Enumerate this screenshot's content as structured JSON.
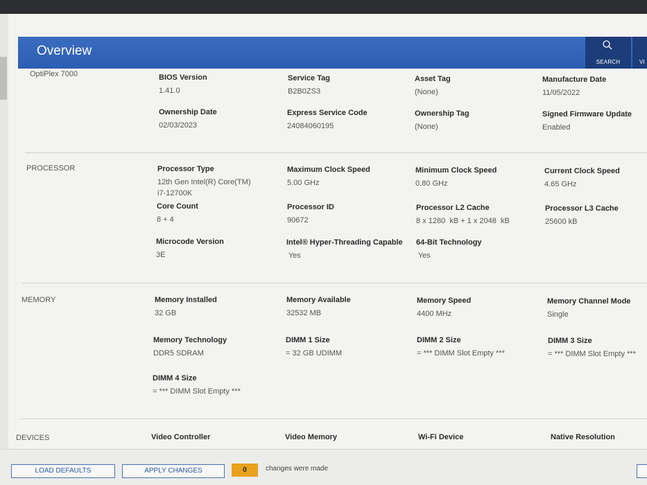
{
  "header": {
    "title": "Overview",
    "search_label": "SEARCH",
    "view_label": "VI"
  },
  "system": {
    "model": "OptiPlex 7000",
    "fields": [
      {
        "label": "BIOS Version",
        "value": "1.41.0"
      },
      {
        "label": "Service Tag",
        "value": "B2B0ZS3"
      },
      {
        "label": "Asset Tag",
        "value": "(None)"
      },
      {
        "label": "Manufacture Date",
        "value": "11/05/2022"
      },
      {
        "label": "Ownership Date",
        "value": "02/03/2023"
      },
      {
        "label": "Express Service Code",
        "value": "24084060195"
      },
      {
        "label": "Ownership Tag",
        "value": "(None)"
      },
      {
        "label": "Signed Firmware Update",
        "value": "Enabled"
      }
    ]
  },
  "processor": {
    "section": "PROCESSOR",
    "fields": [
      {
        "label": "Processor Type",
        "value": "12th Gen Intel(R) Core(TM)\ni7-12700K"
      },
      {
        "label": "Maximum Clock Speed",
        "value": "5.00 GHz"
      },
      {
        "label": "Minimum Clock Speed",
        "value": "0.80 GHz"
      },
      {
        "label": "Current Clock Speed",
        "value": "4.65 GHz"
      },
      {
        "label": "Core Count",
        "value": "8 + 4"
      },
      {
        "label": "Processor ID",
        "value": "90672"
      },
      {
        "label": "Processor L2 Cache",
        "value": "8 x 1280  kB + 1 x 2048  kB"
      },
      {
        "label": "Processor L3 Cache",
        "value": "25600 kB"
      },
      {
        "label": "Microcode Version",
        "value": "3E"
      },
      {
        "label": "Intel® Hyper-Threading Capable",
        "value": " Yes"
      },
      {
        "label": "64-Bit Technology",
        "value": " Yes"
      }
    ]
  },
  "memory": {
    "section": "MEMORY",
    "fields": [
      {
        "label": "Memory Installed",
        "value": "32 GB"
      },
      {
        "label": "Memory Available",
        "value": "32532 MB"
      },
      {
        "label": "Memory Speed",
        "value": "4400 MHz"
      },
      {
        "label": "Memory Channel Mode",
        "value": "Single"
      },
      {
        "label": "Memory Technology",
        "value": "DDR5 SDRAM"
      },
      {
        "label": "DIMM 1 Size",
        "value": "= 32 GB UDIMM"
      },
      {
        "label": "DIMM 2 Size",
        "value": "= *** DIMM Slot Empty ***"
      },
      {
        "label": "DIMM 3 Size",
        "value": "= *** DIMM Slot Empty ***"
      },
      {
        "label": "DIMM 4 Size",
        "value": "= *** DIMM Slot Empty ***"
      }
    ]
  },
  "devices": {
    "section": "DEVICES",
    "fields": [
      {
        "label": "Video Controller"
      },
      {
        "label": "Video Memory"
      },
      {
        "label": "Wi-Fi Device"
      },
      {
        "label": "Native Resolution"
      }
    ]
  },
  "footer": {
    "load_defaults": "LOAD DEFAULTS",
    "apply_changes": "APPLY CHANGES",
    "change_count": "0",
    "changes_text": "changes were made"
  }
}
